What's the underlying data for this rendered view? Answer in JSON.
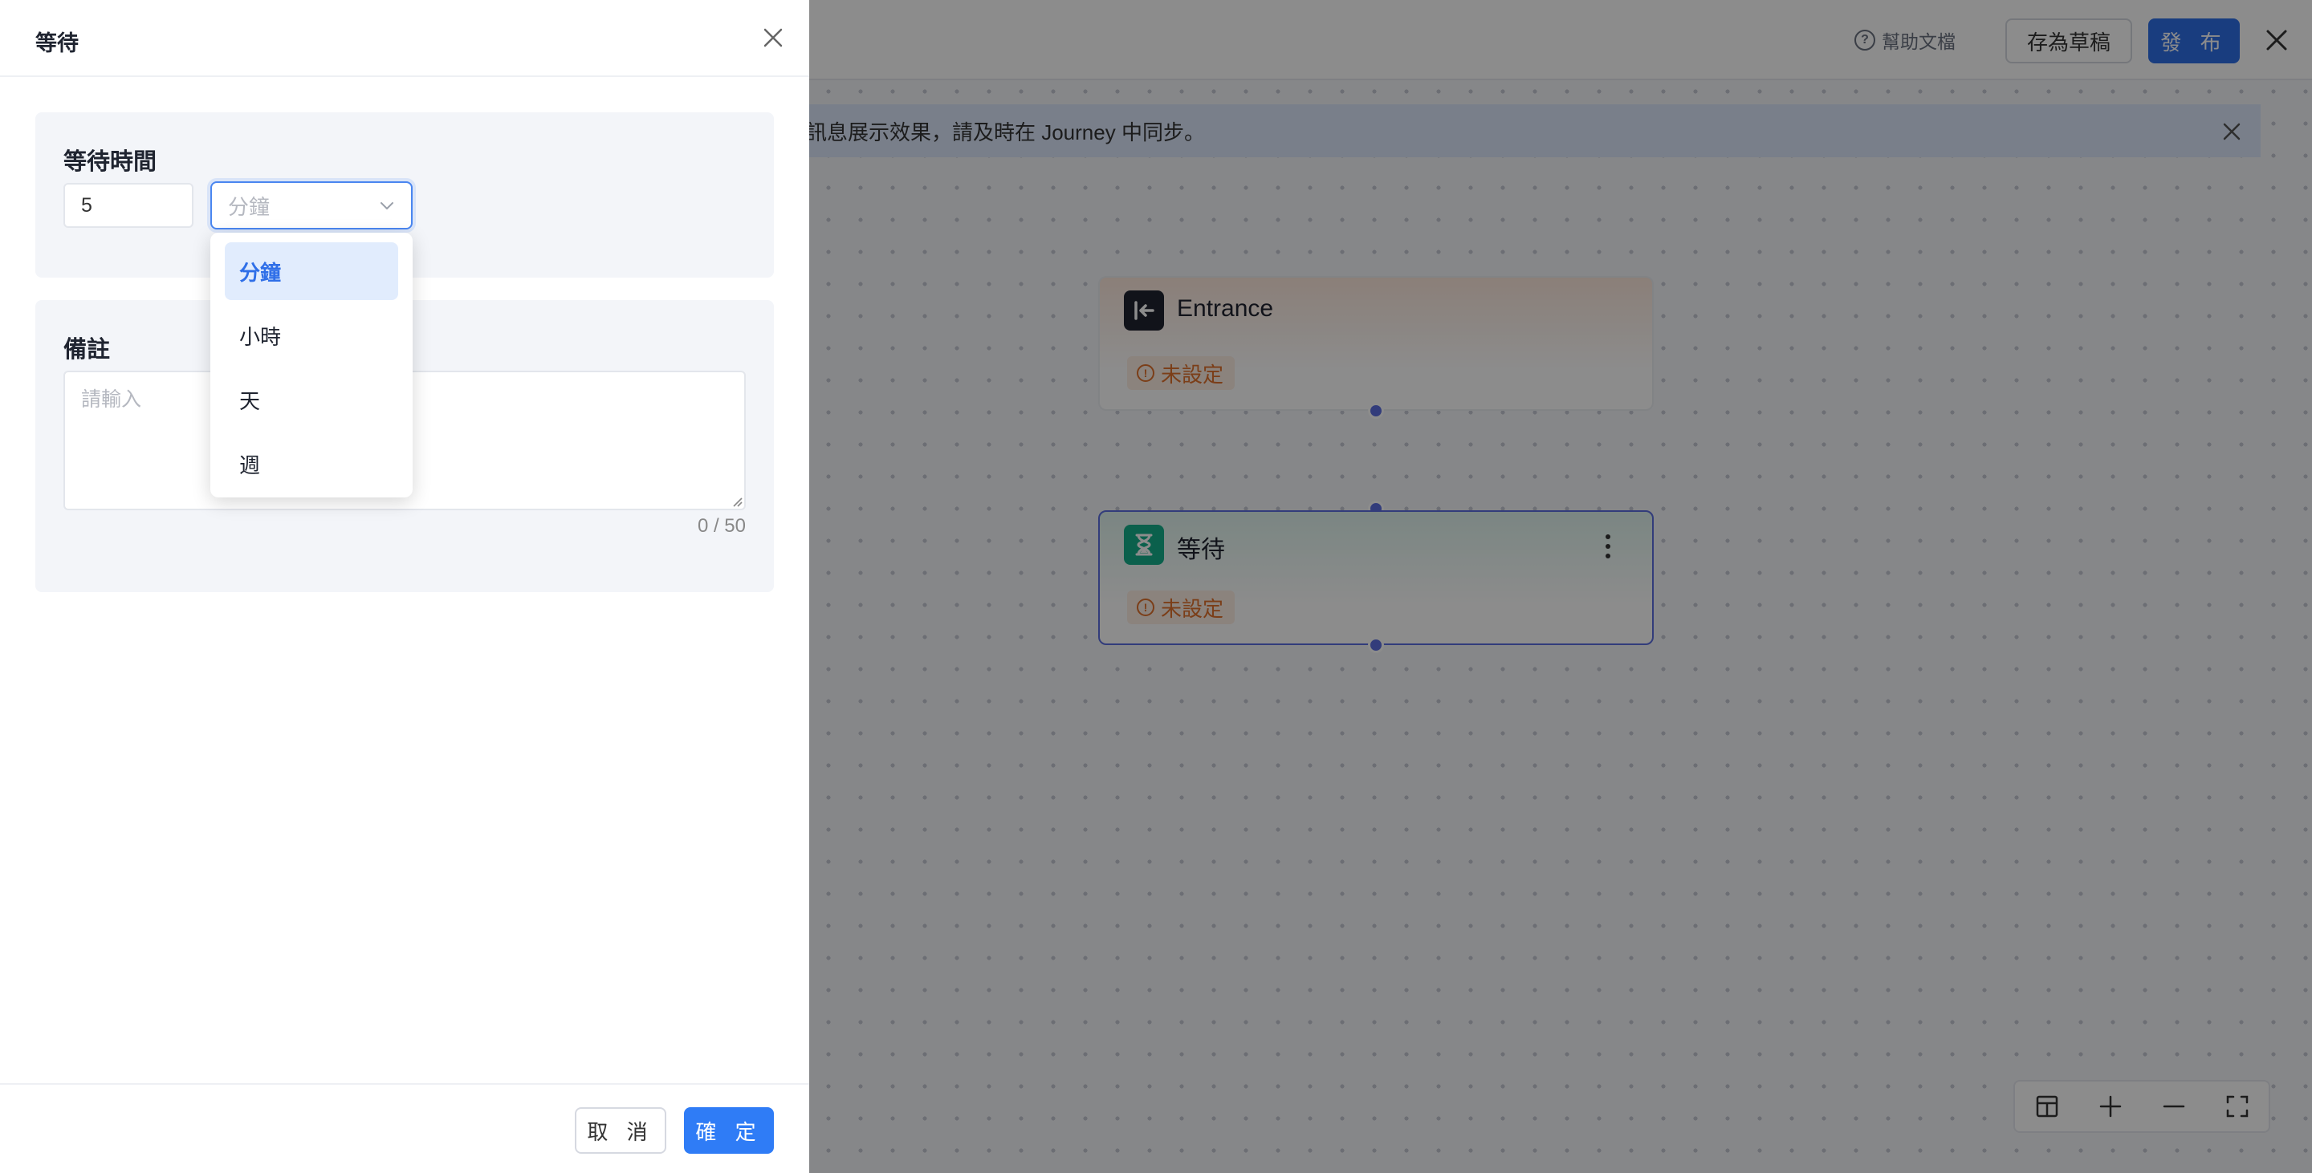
{
  "header": {
    "help_label": "幫助文檔",
    "draft_label": "存為草稿",
    "publish_label": "發 布"
  },
  "notice": {
    "text": "訊息展示效果，請及時在 Journey 中同步。"
  },
  "canvas": {
    "nodes": [
      {
        "title": "Entrance",
        "badge": "未設定",
        "icon": "entrance-icon"
      },
      {
        "title": "等待",
        "badge": "未設定",
        "icon": "hourglass-icon"
      }
    ]
  },
  "drawer": {
    "title": "等待",
    "wait_section_label": "等待時間",
    "wait_amount": "5",
    "unit_placeholder": "分鐘",
    "unit_options": [
      "分鐘",
      "小時",
      "天",
      "週"
    ],
    "unit_active_index": 0,
    "note_label": "備註",
    "note_placeholder": "請輸入",
    "note_counter": "0 / 50",
    "cancel_label": "取 消",
    "confirm_label": "確 定"
  },
  "colors": {
    "primary": "#2f6fe8",
    "warning": "#e0712c",
    "entrance_icon_bg": "#1f2430",
    "wait_icon_bg": "#14b08a"
  }
}
